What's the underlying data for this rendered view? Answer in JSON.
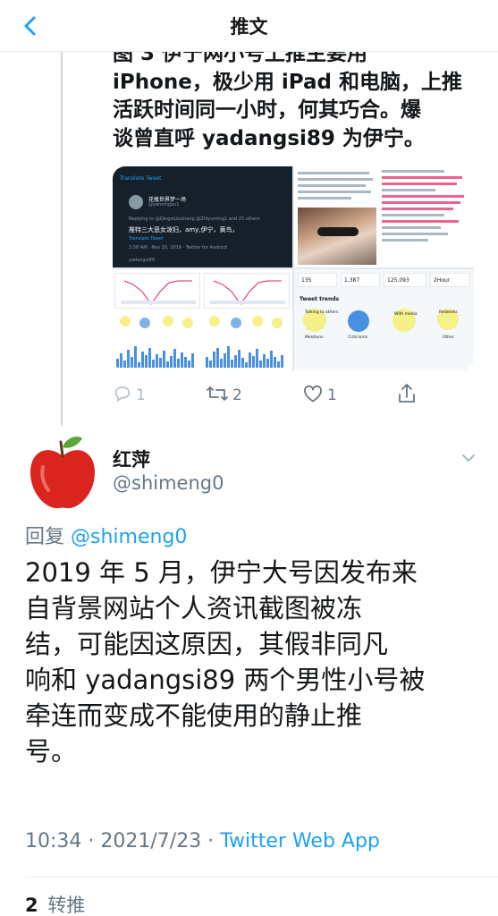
{
  "header": {
    "title": "推文"
  },
  "previous_tweet": {
    "text_lines": [
      "图 3 伊宁网小号上推主要用",
      "iPhone，极少用 iPad 和电脑，上推",
      "活跃时间同一小时，何其巧合。爆",
      "谈曾直呼 yadangsi89 为伊宁。"
    ],
    "media": {
      "translate_link": "Translate Tweet",
      "card_name": "花瓶世界梦一场",
      "card_handle": "@yanningxu1",
      "card_reply": "Replying to @Qingxiulushang @Zhiyuming1 and 25 others",
      "card_body": "推特三大恶女泼妇，amy,伊宁，黄鸟，",
      "card_translate": "Translate Tweet",
      "card_meta": "2:58 AM · Nov 20, 2018 · Twitter for Android",
      "card_footer": "yadangsi89",
      "stats": [
        "135",
        "1,387",
        "125,093",
        "2Hour"
      ],
      "tweet_trends_title": "Tweet trends",
      "trend_labels": [
        "Talking to others",
        "Mentions",
        "Criticisms",
        "With media",
        "Retweets",
        "Other"
      ]
    },
    "actions": {
      "reply_count": "1",
      "retweet_count": "2",
      "like_count": "1"
    }
  },
  "tweet": {
    "display_name": "红萍",
    "username": "@shimeng0",
    "reply_prefix": "回复",
    "reply_to": "@shimeng0",
    "text_lines": [
      "2019 年 5 月，伊宁大号因发布来",
      "自背景网站个人资讯截图被冻",
      "结，可能因这原因，其假非同凡",
      "响和 yadangsi89 两个男性小号被",
      "牵连而变成不能使用的静止推",
      "号。"
    ],
    "time": "10:34",
    "date": "2021/7/23",
    "separator": "·",
    "source": "Twitter Web App",
    "retweets": "2",
    "retweets_label": "转推"
  },
  "colors": {
    "accent": "#1da1f2",
    "secondary_text": "#657786",
    "apple_red": "#d9251d"
  }
}
